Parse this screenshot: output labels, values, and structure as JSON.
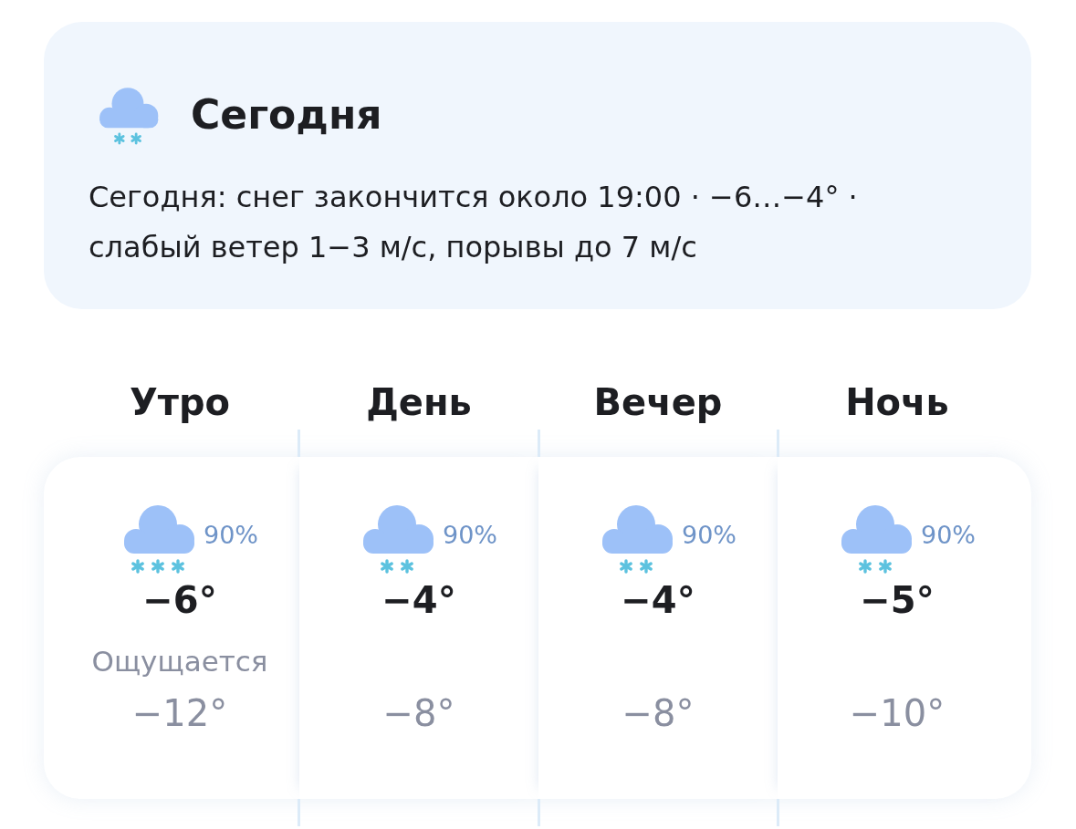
{
  "today": {
    "title": "Сегодня",
    "icon": {
      "kind": "flurry"
    },
    "summary": "Сегодня: снег закончится около 19:00 · −6…−4° · слабый ветер 1−3 м/с, порывы до 7 м/с"
  },
  "periods": [
    {
      "name": "Утро",
      "icon": {
        "kind": "snow"
      },
      "chance": "90%",
      "temp": "−6°",
      "feels_label": "Ощущается",
      "feels": "−12°"
    },
    {
      "name": "День",
      "icon": {
        "kind": "flurry"
      },
      "chance": "90%",
      "temp": "−4°",
      "feels": "−8°"
    },
    {
      "name": "Вечер",
      "icon": {
        "kind": "flurry"
      },
      "chance": "90%",
      "temp": "−4°",
      "feels": "−8°"
    },
    {
      "name": "Ночь",
      "icon": {
        "kind": "flurry"
      },
      "chance": "90%",
      "temp": "−5°",
      "feels": "−10°"
    }
  ]
}
